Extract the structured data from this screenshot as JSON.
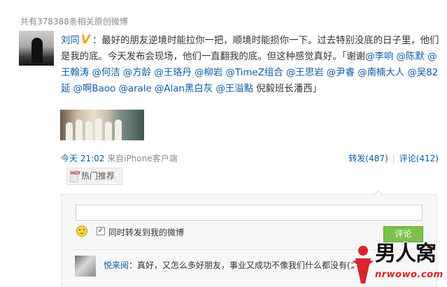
{
  "search": {
    "result_count": "共有378388条相关原创微博"
  },
  "post": {
    "author": "刘同",
    "verified_badge": "V",
    "colon": "：",
    "text_main": "最好的朋友逆境时能拉你一把，顺境时能损你一下。过去特别没底的日子里，他们是我的底。今天发布会现场，他们一直翻我的底。但这种感觉真好。「谢谢",
    "mentions": [
      "@李响",
      "@陈默",
      "@王翰涛",
      "@何洁",
      "@方龄",
      "@王珞丹",
      "@柳岩",
      "@TimeZ组合",
      "@王思岩",
      "@尹睿",
      "@南楠大人",
      "@吴82延",
      "@啊Baoo",
      "@arale",
      "@Alan黑白灰",
      "@王溢點"
    ],
    "text_tail": " 倪毅班长潘西」",
    "time": "今天 21:02",
    "source": "来自iPhone客户端",
    "repost_label": "转发(487)",
    "separator": "|",
    "comment_label": "评论(412)"
  },
  "hot_button": {
    "flag": "HOT",
    "label": "热门推荐"
  },
  "comment_box": {
    "input_value": "",
    "repost_checkbox_checked": true,
    "checkbox_mark": "✓",
    "repost_label": "同时转发到我的微博",
    "submit_label": "评论"
  },
  "comment": {
    "user": "悦来阅",
    "colon": "：",
    "text": "真好，又怎么多好朋友，事业又成功不像我们什么都没有(之"
  },
  "watermark": {
    "main": "男人窝",
    "sub": "nrwowo.com"
  },
  "colors": {
    "link": "#0a5aa7",
    "submit_green": "#7bc14a",
    "badge_orange": "#f5a316",
    "watermark_red": "#d6262e"
  }
}
